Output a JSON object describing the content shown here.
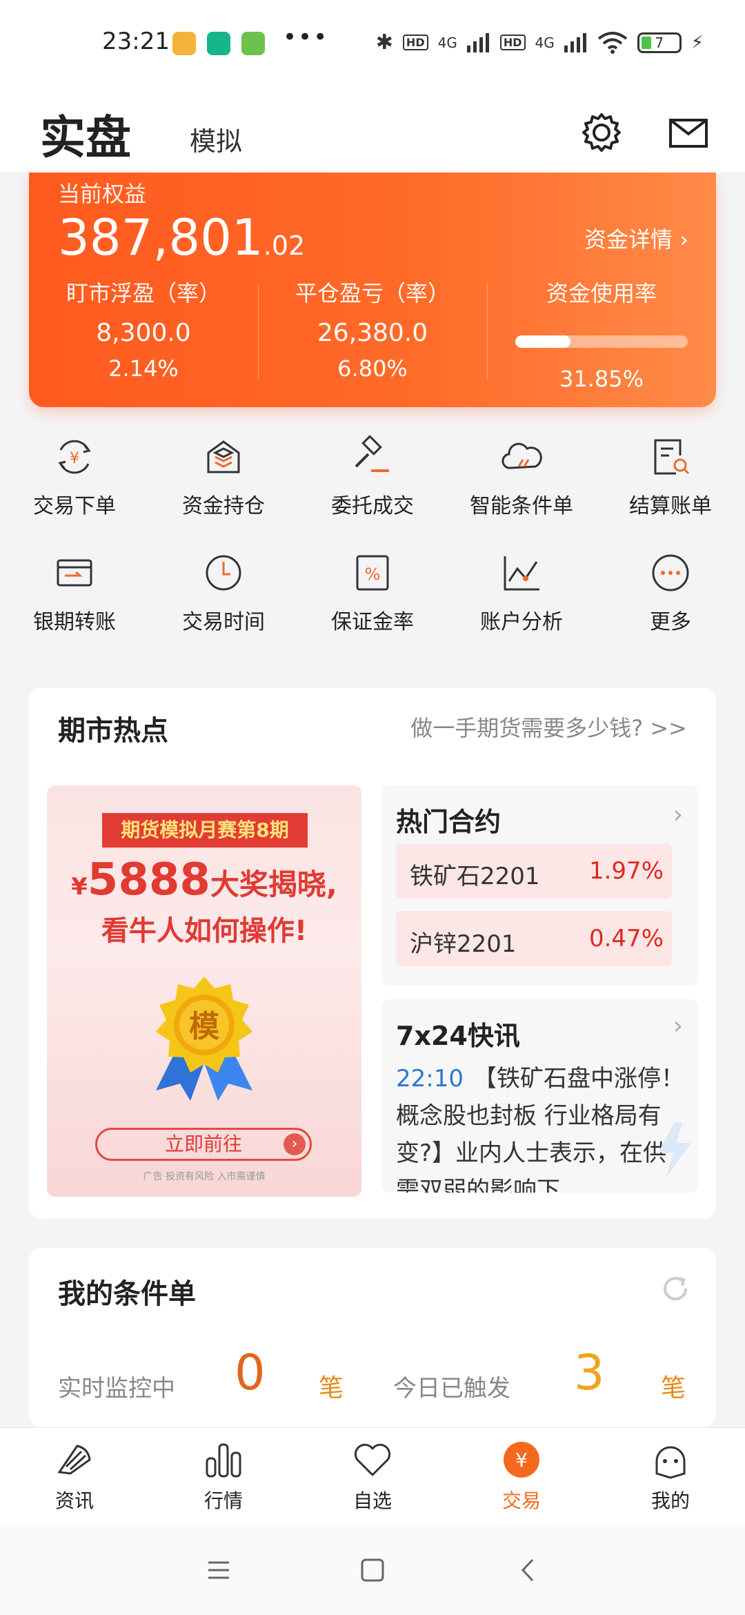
{
  "status_bar": {
    "time": "23:21",
    "more": "•••",
    "hd1": "HD",
    "net1": "4G",
    "hd2": "HD",
    "net2": "4G",
    "battery": "7"
  },
  "header": {
    "tab_real": "实盘",
    "tab_sim": "模拟",
    "settings_icon": "gear-icon",
    "mail_icon": "mail-icon"
  },
  "equity": {
    "label": "当前权益",
    "value_int": "387,801",
    "value_dec": ".02",
    "detail_link": "资金详情 ›",
    "col1_label": "盯市浮盈（率）",
    "col1_value": "8,300.0",
    "col1_rate": "2.14%",
    "col2_label": "平仓盈亏（率）",
    "col2_value": "26,380.0",
    "col2_rate": "6.80%",
    "col3_label": "资金使用率",
    "col3_rate": "31.85%",
    "usage_fraction": 0.3185
  },
  "functions": [
    {
      "label": "交易下单",
      "icon": "yuan-exchange-icon"
    },
    {
      "label": "资金持仓",
      "icon": "stack-house-icon"
    },
    {
      "label": "委托成交",
      "icon": "gavel-icon"
    },
    {
      "label": "智能条件单",
      "icon": "cloud-icon"
    },
    {
      "label": "结算账单",
      "icon": "bill-search-icon"
    },
    {
      "label": "银期转账",
      "icon": "card-transfer-icon"
    },
    {
      "label": "交易时间",
      "icon": "clock-icon"
    },
    {
      "label": "保证金率",
      "icon": "percent-icon"
    },
    {
      "label": "账户分析",
      "icon": "line-chart-icon"
    },
    {
      "label": "更多",
      "icon": "more-icon"
    }
  ],
  "hot": {
    "title": "期市热点",
    "link": "做一手期货需要多少钱? >>",
    "promo": {
      "ribbon": "期货模拟月赛第8期",
      "currency": "¥",
      "amount": "5888",
      "line1_suffix": "大奖揭晓,",
      "line2": "看牛人如何操作!",
      "medal_char": "模",
      "button": "立即前往",
      "note": "广告 投资有风险 入市需谨慎"
    },
    "contracts": {
      "title": "热门合约",
      "items": [
        {
          "name": "铁矿石2201",
          "change": "1.97%"
        },
        {
          "name": "沪锌2201",
          "change": "0.47%"
        }
      ]
    },
    "news": {
      "title": "7x24快讯",
      "time": "22:10",
      "text": "【铁矿石盘中涨停！概念股也封板 行业格局有变?】业内人士表示，在供需双弱的影响下"
    }
  },
  "conditions": {
    "title": "我的条件单",
    "monitoring_label": "实时监控中",
    "monitoring_count": "0",
    "monitoring_unit": "笔",
    "triggered_label": "今日已触发",
    "triggered_count": "3",
    "triggered_unit": "笔"
  },
  "bottom_nav": [
    {
      "label": "资讯",
      "icon": "news-icon",
      "active": false
    },
    {
      "label": "行情",
      "icon": "bar-chart-icon",
      "active": false
    },
    {
      "label": "自选",
      "icon": "heart-icon",
      "active": false
    },
    {
      "label": "交易",
      "icon": "yuan-circle-icon",
      "active": true
    },
    {
      "label": "我的",
      "icon": "profile-icon",
      "active": false
    }
  ],
  "colors": {
    "accent": "#ff5a1f",
    "up_red": "#e0291f",
    "monitor_orange": "#e0661a",
    "trigger_yellow": "#f0a41e"
  }
}
